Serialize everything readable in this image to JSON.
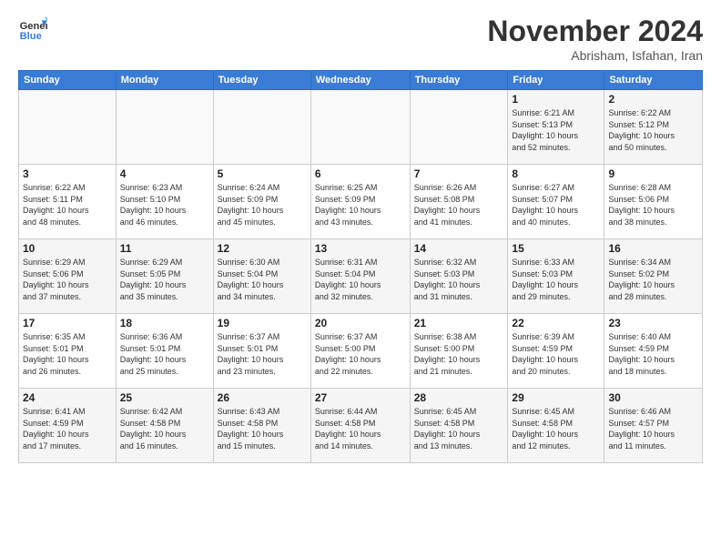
{
  "header": {
    "logo_line1": "General",
    "logo_line2": "Blue",
    "month_title": "November 2024",
    "location": "Abrisham, Isfahan, Iran"
  },
  "weekdays": [
    "Sunday",
    "Monday",
    "Tuesday",
    "Wednesday",
    "Thursday",
    "Friday",
    "Saturday"
  ],
  "weeks": [
    [
      {
        "day": "",
        "info": ""
      },
      {
        "day": "",
        "info": ""
      },
      {
        "day": "",
        "info": ""
      },
      {
        "day": "",
        "info": ""
      },
      {
        "day": "",
        "info": ""
      },
      {
        "day": "1",
        "info": "Sunrise: 6:21 AM\nSunset: 5:13 PM\nDaylight: 10 hours\nand 52 minutes."
      },
      {
        "day": "2",
        "info": "Sunrise: 6:22 AM\nSunset: 5:12 PM\nDaylight: 10 hours\nand 50 minutes."
      }
    ],
    [
      {
        "day": "3",
        "info": "Sunrise: 6:22 AM\nSunset: 5:11 PM\nDaylight: 10 hours\nand 48 minutes."
      },
      {
        "day": "4",
        "info": "Sunrise: 6:23 AM\nSunset: 5:10 PM\nDaylight: 10 hours\nand 46 minutes."
      },
      {
        "day": "5",
        "info": "Sunrise: 6:24 AM\nSunset: 5:09 PM\nDaylight: 10 hours\nand 45 minutes."
      },
      {
        "day": "6",
        "info": "Sunrise: 6:25 AM\nSunset: 5:09 PM\nDaylight: 10 hours\nand 43 minutes."
      },
      {
        "day": "7",
        "info": "Sunrise: 6:26 AM\nSunset: 5:08 PM\nDaylight: 10 hours\nand 41 minutes."
      },
      {
        "day": "8",
        "info": "Sunrise: 6:27 AM\nSunset: 5:07 PM\nDaylight: 10 hours\nand 40 minutes."
      },
      {
        "day": "9",
        "info": "Sunrise: 6:28 AM\nSunset: 5:06 PM\nDaylight: 10 hours\nand 38 minutes."
      }
    ],
    [
      {
        "day": "10",
        "info": "Sunrise: 6:29 AM\nSunset: 5:06 PM\nDaylight: 10 hours\nand 37 minutes."
      },
      {
        "day": "11",
        "info": "Sunrise: 6:29 AM\nSunset: 5:05 PM\nDaylight: 10 hours\nand 35 minutes."
      },
      {
        "day": "12",
        "info": "Sunrise: 6:30 AM\nSunset: 5:04 PM\nDaylight: 10 hours\nand 34 minutes."
      },
      {
        "day": "13",
        "info": "Sunrise: 6:31 AM\nSunset: 5:04 PM\nDaylight: 10 hours\nand 32 minutes."
      },
      {
        "day": "14",
        "info": "Sunrise: 6:32 AM\nSunset: 5:03 PM\nDaylight: 10 hours\nand 31 minutes."
      },
      {
        "day": "15",
        "info": "Sunrise: 6:33 AM\nSunset: 5:03 PM\nDaylight: 10 hours\nand 29 minutes."
      },
      {
        "day": "16",
        "info": "Sunrise: 6:34 AM\nSunset: 5:02 PM\nDaylight: 10 hours\nand 28 minutes."
      }
    ],
    [
      {
        "day": "17",
        "info": "Sunrise: 6:35 AM\nSunset: 5:01 PM\nDaylight: 10 hours\nand 26 minutes."
      },
      {
        "day": "18",
        "info": "Sunrise: 6:36 AM\nSunset: 5:01 PM\nDaylight: 10 hours\nand 25 minutes."
      },
      {
        "day": "19",
        "info": "Sunrise: 6:37 AM\nSunset: 5:01 PM\nDaylight: 10 hours\nand 23 minutes."
      },
      {
        "day": "20",
        "info": "Sunrise: 6:37 AM\nSunset: 5:00 PM\nDaylight: 10 hours\nand 22 minutes."
      },
      {
        "day": "21",
        "info": "Sunrise: 6:38 AM\nSunset: 5:00 PM\nDaylight: 10 hours\nand 21 minutes."
      },
      {
        "day": "22",
        "info": "Sunrise: 6:39 AM\nSunset: 4:59 PM\nDaylight: 10 hours\nand 20 minutes."
      },
      {
        "day": "23",
        "info": "Sunrise: 6:40 AM\nSunset: 4:59 PM\nDaylight: 10 hours\nand 18 minutes."
      }
    ],
    [
      {
        "day": "24",
        "info": "Sunrise: 6:41 AM\nSunset: 4:59 PM\nDaylight: 10 hours\nand 17 minutes."
      },
      {
        "day": "25",
        "info": "Sunrise: 6:42 AM\nSunset: 4:58 PM\nDaylight: 10 hours\nand 16 minutes."
      },
      {
        "day": "26",
        "info": "Sunrise: 6:43 AM\nSunset: 4:58 PM\nDaylight: 10 hours\nand 15 minutes."
      },
      {
        "day": "27",
        "info": "Sunrise: 6:44 AM\nSunset: 4:58 PM\nDaylight: 10 hours\nand 14 minutes."
      },
      {
        "day": "28",
        "info": "Sunrise: 6:45 AM\nSunset: 4:58 PM\nDaylight: 10 hours\nand 13 minutes."
      },
      {
        "day": "29",
        "info": "Sunrise: 6:45 AM\nSunset: 4:58 PM\nDaylight: 10 hours\nand 12 minutes."
      },
      {
        "day": "30",
        "info": "Sunrise: 6:46 AM\nSunset: 4:57 PM\nDaylight: 10 hours\nand 11 minutes."
      }
    ]
  ]
}
